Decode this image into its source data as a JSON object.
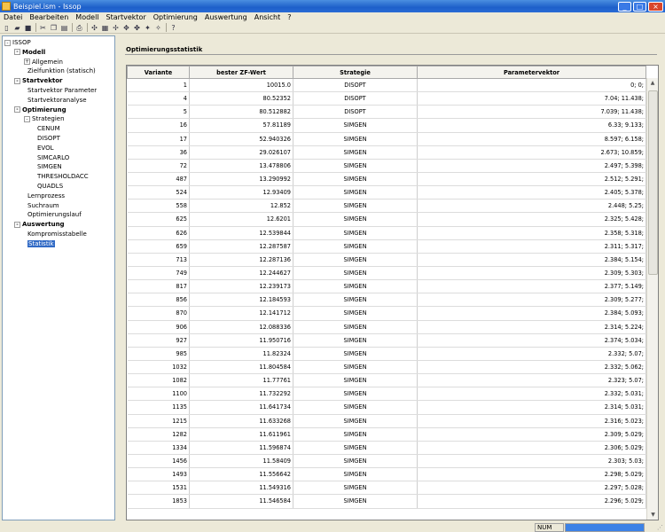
{
  "window": {
    "title": "Beispiel.ism - Issop"
  },
  "menu": [
    "Datei",
    "Bearbeiten",
    "Modell",
    "Startvektor",
    "Optimierung",
    "Auswertung",
    "Ansicht",
    "?"
  ],
  "toolbar": [
    {
      "name": "new-file-icon",
      "glyph": "▯"
    },
    {
      "name": "open-folder-icon",
      "glyph": "▰"
    },
    {
      "name": "save-icon",
      "glyph": "■"
    },
    {
      "sep": true
    },
    {
      "name": "cut-icon",
      "glyph": "✂"
    },
    {
      "name": "copy-icon",
      "glyph": "❐"
    },
    {
      "name": "paste-icon",
      "glyph": "▤"
    },
    {
      "sep": true
    },
    {
      "name": "print-icon",
      "glyph": "⎙"
    },
    {
      "sep": true
    },
    {
      "name": "model-icon",
      "glyph": "✣"
    },
    {
      "name": "table-icon",
      "glyph": "▦"
    },
    {
      "name": "vector-icon",
      "glyph": "✢"
    },
    {
      "name": "optimize-icon",
      "glyph": "✥"
    },
    {
      "name": "run-icon",
      "glyph": "✤"
    },
    {
      "name": "stop-icon",
      "glyph": "✦"
    },
    {
      "name": "settings-icon",
      "glyph": "✧"
    },
    {
      "sep": true
    },
    {
      "name": "help-icon",
      "glyph": "?"
    }
  ],
  "tree": [
    {
      "label": "ISSOP",
      "depth": 0,
      "bold": false,
      "expander": "-"
    },
    {
      "label": "Modell",
      "depth": 1,
      "bold": true,
      "expander": "-"
    },
    {
      "label": "Allgemein",
      "depth": 2,
      "bold": false,
      "expander": "+"
    },
    {
      "label": "Zielfunktion (statisch)",
      "depth": 2,
      "bold": false,
      "expander": ""
    },
    {
      "label": "Startvektor",
      "depth": 1,
      "bold": true,
      "expander": "-"
    },
    {
      "label": "Startvektor Parameter",
      "depth": 2,
      "bold": false,
      "expander": ""
    },
    {
      "label": "Startvektoranalyse",
      "depth": 2,
      "bold": false,
      "expander": ""
    },
    {
      "label": "Optimierung",
      "depth": 1,
      "bold": true,
      "expander": "-"
    },
    {
      "label": "Strategien",
      "depth": 2,
      "bold": false,
      "expander": "-"
    },
    {
      "label": "CENUM",
      "depth": 3,
      "bold": false,
      "expander": ""
    },
    {
      "label": "DISOPT",
      "depth": 3,
      "bold": false,
      "expander": ""
    },
    {
      "label": "EVOL",
      "depth": 3,
      "bold": false,
      "expander": ""
    },
    {
      "label": "SIMCARLO",
      "depth": 3,
      "bold": false,
      "expander": ""
    },
    {
      "label": "SIMGEN",
      "depth": 3,
      "bold": false,
      "expander": ""
    },
    {
      "label": "THRESHOLDACC",
      "depth": 3,
      "bold": false,
      "expander": ""
    },
    {
      "label": "QUADLS",
      "depth": 3,
      "bold": false,
      "expander": ""
    },
    {
      "label": "Lernprozess",
      "depth": 2,
      "bold": false,
      "expander": ""
    },
    {
      "label": "Suchraum",
      "depth": 2,
      "bold": false,
      "expander": ""
    },
    {
      "label": "Optimierungslauf",
      "depth": 2,
      "bold": false,
      "expander": ""
    },
    {
      "label": "Auswertung",
      "depth": 1,
      "bold": true,
      "expander": "-"
    },
    {
      "label": "Kompromisstabelle",
      "depth": 2,
      "bold": false,
      "expander": ""
    },
    {
      "label": "Statistik",
      "depth": 2,
      "bold": false,
      "expander": "",
      "selected": true
    }
  ],
  "panel": {
    "title": "Optimierungsstatistik",
    "columns": [
      "Variante",
      "bester ZF-Wert",
      "Strategie",
      "Parametervektor"
    ],
    "rows": [
      [
        "1",
        "10015.0",
        "DISOPT",
        "0; 0;"
      ],
      [
        "4",
        "80.52352",
        "DISOPT",
        "7.04; 11.438;"
      ],
      [
        "5",
        "80.512882",
        "DISOPT",
        "7.039; 11.438;"
      ],
      [
        "16",
        "57.81189",
        "SIMGEN",
        "6.33; 9.133;"
      ],
      [
        "17",
        "52.940326",
        "SIMGEN",
        "8.597; 6.158;"
      ],
      [
        "36",
        "29.026107",
        "SIMGEN",
        "2.673; 10.859;"
      ],
      [
        "72",
        "13.478806",
        "SIMGEN",
        "2.497; 5.398;"
      ],
      [
        "487",
        "13.290992",
        "SIMGEN",
        "2.512; 5.291;"
      ],
      [
        "524",
        "12.93409",
        "SIMGEN",
        "2.405; 5.378;"
      ],
      [
        "558",
        "12.852",
        "SIMGEN",
        "2.448; 5.25;"
      ],
      [
        "625",
        "12.6201",
        "SIMGEN",
        "2.325; 5.428;"
      ],
      [
        "626",
        "12.539844",
        "SIMGEN",
        "2.358; 5.318;"
      ],
      [
        "659",
        "12.287587",
        "SIMGEN",
        "2.311; 5.317;"
      ],
      [
        "713",
        "12.287136",
        "SIMGEN",
        "2.384; 5.154;"
      ],
      [
        "749",
        "12.244627",
        "SIMGEN",
        "2.309; 5.303;"
      ],
      [
        "817",
        "12.239173",
        "SIMGEN",
        "2.377; 5.149;"
      ],
      [
        "856",
        "12.184593",
        "SIMGEN",
        "2.309; 5.277;"
      ],
      [
        "870",
        "12.141712",
        "SIMGEN",
        "2.384; 5.093;"
      ],
      [
        "906",
        "12.088336",
        "SIMGEN",
        "2.314; 5.224;"
      ],
      [
        "927",
        "11.950716",
        "SIMGEN",
        "2.374; 5.034;"
      ],
      [
        "985",
        "11.82324",
        "SIMGEN",
        "2.332; 5.07;"
      ],
      [
        "1032",
        "11.804584",
        "SIMGEN",
        "2.332; 5.062;"
      ],
      [
        "1082",
        "11.77761",
        "SIMGEN",
        "2.323; 5.07;"
      ],
      [
        "1100",
        "11.732292",
        "SIMGEN",
        "2.332; 5.031;"
      ],
      [
        "1135",
        "11.641734",
        "SIMGEN",
        "2.314; 5.031;"
      ],
      [
        "1215",
        "11.633268",
        "SIMGEN",
        "2.316; 5.023;"
      ],
      [
        "1282",
        "11.611961",
        "SIMGEN",
        "2.309; 5.029;"
      ],
      [
        "1334",
        "11.596874",
        "SIMGEN",
        "2.306; 5.029;"
      ],
      [
        "1456",
        "11.58409",
        "SIMGEN",
        "2.303; 5.03;"
      ],
      [
        "1493",
        "11.556642",
        "SIMGEN",
        "2.298; 5.029;"
      ],
      [
        "1531",
        "11.549316",
        "SIMGEN",
        "2.297; 5.028;"
      ],
      [
        "1853",
        "11.546584",
        "SIMGEN",
        "2.296; 5.029;"
      ]
    ]
  },
  "status": {
    "num": "NUM",
    "progress_percent": 100,
    "progress_color": "#3c82e6"
  },
  "colors": {
    "selection": "#316ac5",
    "titlebar": "#1d5fc9"
  }
}
